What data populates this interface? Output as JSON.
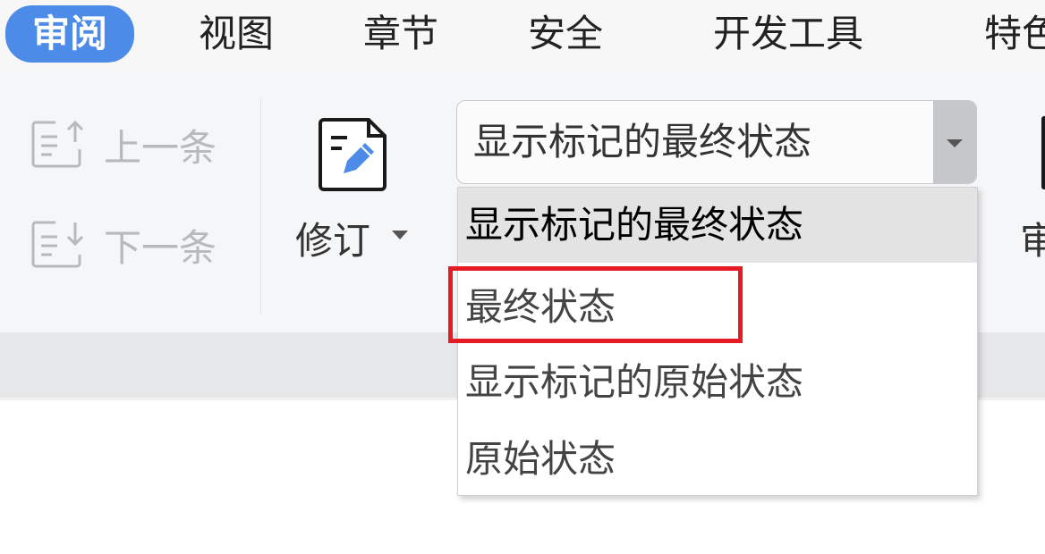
{
  "tabs": [
    {
      "label": "审阅",
      "active": true
    },
    {
      "label": "视图"
    },
    {
      "label": "章节"
    },
    {
      "label": "安全"
    },
    {
      "label": "开发工具"
    },
    {
      "label": "特色"
    }
  ],
  "ribbon": {
    "prev_label": "上一条",
    "next_label": "下一条",
    "revise_label": "修订",
    "right_partial_label": "审"
  },
  "display_mode": {
    "selected": "显示标记的最终状态",
    "options": [
      "显示标记的最终状态",
      "最终状态",
      "显示标记的原始状态",
      "原始状态"
    ],
    "highlighted_option": "最终状态"
  },
  "colors": {
    "accent": "#4c8be8",
    "highlight": "#e51c23",
    "disabled_text": "#b8b9bb"
  },
  "icons": {
    "prev": "previous-change-icon",
    "next": "next-change-icon",
    "revise": "revise-pencil-icon",
    "combo": "chevron-down-icon"
  }
}
